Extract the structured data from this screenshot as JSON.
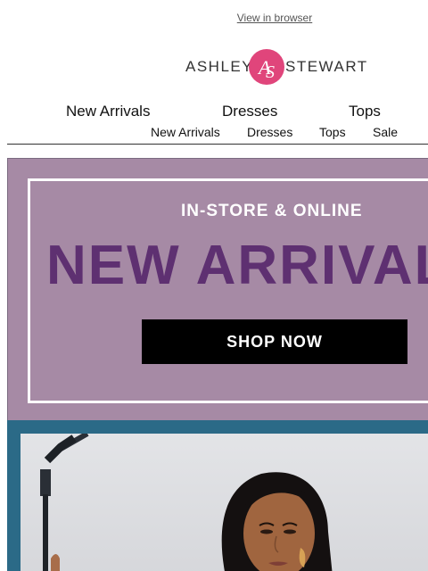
{
  "header": {
    "view_in_browser": "View in browser"
  },
  "logo": {
    "word_left": "ASHLEY",
    "word_right": "STEWART",
    "monogram": "AS"
  },
  "nav_main": [
    "New Arrivals",
    "Dresses",
    "Tops"
  ],
  "nav_sub": [
    "New Arrivals",
    "Dresses",
    "Tops",
    "Sale"
  ],
  "banner": {
    "subtitle": "IN-STORE & ONLINE",
    "headline": "NEW ARRIVALS",
    "cta": "SHOP NOW"
  },
  "colors": {
    "banner_bg": "#a68aa5",
    "headline": "#5e3071",
    "hero_frame": "#2b6a87",
    "logo_pink": "#e0457b"
  },
  "icons": {
    "logo_mark": "ashley-stewart-monogram"
  }
}
